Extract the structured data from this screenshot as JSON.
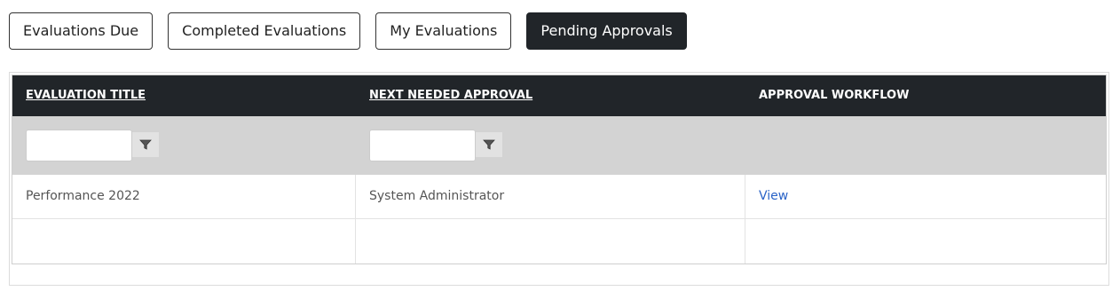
{
  "tabs": [
    {
      "label": "Evaluations Due",
      "active": false
    },
    {
      "label": "Completed Evaluations",
      "active": false
    },
    {
      "label": "My Evaluations",
      "active": false
    },
    {
      "label": "Pending Approvals",
      "active": true
    }
  ],
  "grid": {
    "columns": [
      {
        "label": "EVALUATION TITLE",
        "sortable": true
      },
      {
        "label": "NEXT NEEDED APPROVAL",
        "sortable": true
      },
      {
        "label": "APPROVAL WORKFLOW",
        "sortable": false
      }
    ],
    "filters": {
      "title_value": "",
      "approval_value": ""
    },
    "rows": [
      {
        "title": "Performance 2022",
        "next_approval": "System Administrator",
        "workflow_link": "View"
      }
    ]
  },
  "icons": {
    "filter": "filter-icon"
  }
}
